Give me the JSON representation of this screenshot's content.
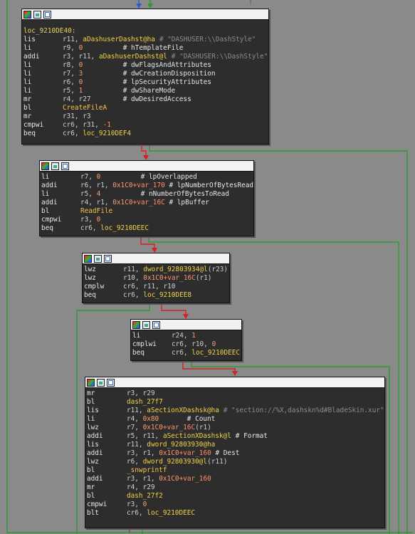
{
  "view": {
    "background": "#8a8a8a",
    "node_background": "#2d2d2d",
    "edge_colors": {
      "taken": "#2e9a2e",
      "fallthrough": "#d32020",
      "unconditional": "#2a5ad8"
    }
  },
  "nodes": [
    {
      "id": "block1",
      "label": "loc_9210DE40:",
      "lines": [
        {
          "m": "lis",
          "parts": [
            {
              "t": "r11, ",
              "k": "reg"
            },
            {
              "t": "aDashuserDashst@ha",
              "k": "sym"
            },
            {
              "t": " # ",
              "k": "cmt"
            },
            {
              "t": "\"DASHUSER:\\\\DashStyle\"",
              "k": "cmt"
            }
          ]
        },
        {
          "m": "li",
          "parts": [
            {
              "t": "r9, ",
              "k": "reg"
            },
            {
              "t": "0",
              "k": "num"
            },
            {
              "t": "          # hTemplateFile",
              "k": "nm"
            }
          ]
        },
        {
          "m": "addi",
          "parts": [
            {
              "t": "r3, r11, ",
              "k": "reg"
            },
            {
              "t": "aDashuserDashst@l",
              "k": "sym"
            },
            {
              "t": " # ",
              "k": "cmt"
            },
            {
              "t": "\"DASHUSER:\\\\DashStyle\"",
              "k": "cmt"
            }
          ]
        },
        {
          "m": "li",
          "parts": [
            {
              "t": "r8, ",
              "k": "reg"
            },
            {
              "t": "0",
              "k": "num"
            },
            {
              "t": "          # dwFlagsAndAttributes",
              "k": "nm"
            }
          ]
        },
        {
          "m": "li",
          "parts": [
            {
              "t": "r7, ",
              "k": "reg"
            },
            {
              "t": "3",
              "k": "num"
            },
            {
              "t": "          # dwCreationDisposition",
              "k": "nm"
            }
          ]
        },
        {
          "m": "li",
          "parts": [
            {
              "t": "r6, ",
              "k": "reg"
            },
            {
              "t": "0",
              "k": "num"
            },
            {
              "t": "          # lpSecurityAttributes",
              "k": "nm"
            }
          ]
        },
        {
          "m": "li",
          "parts": [
            {
              "t": "r5, ",
              "k": "reg"
            },
            {
              "t": "1",
              "k": "num"
            },
            {
              "t": "          # dwShareMode",
              "k": "nm"
            }
          ]
        },
        {
          "m": "mr",
          "parts": [
            {
              "t": "r4, r27",
              "k": "reg"
            },
            {
              "t": "        # dwDesiredAccess",
              "k": "nm"
            }
          ]
        },
        {
          "m": "bl",
          "parts": [
            {
              "t": "CreateFileA",
              "k": "fc"
            }
          ]
        },
        {
          "m": "mr",
          "parts": [
            {
              "t": "r31, r3",
              "k": "reg"
            }
          ]
        },
        {
          "m": "cmpwi",
          "parts": [
            {
              "t": "cr6, r31, ",
              "k": "reg"
            },
            {
              "t": "-1",
              "k": "num"
            }
          ]
        },
        {
          "m": "beq",
          "parts": [
            {
              "t": "cr6, ",
              "k": "reg"
            },
            {
              "t": "loc_9210DEF4",
              "k": "sym"
            }
          ]
        }
      ]
    },
    {
      "id": "block2",
      "label": "",
      "lines": [
        {
          "m": "li",
          "parts": [
            {
              "t": "r7, ",
              "k": "reg"
            },
            {
              "t": "0",
              "k": "num"
            },
            {
              "t": "          # lpOverlapped",
              "k": "nm"
            }
          ]
        },
        {
          "m": "addi",
          "parts": [
            {
              "t": "r6, r1, ",
              "k": "reg"
            },
            {
              "t": "0x1C0",
              "k": "num"
            },
            {
              "t": "+var_170",
              "k": "var"
            },
            {
              "t": " # lpNumberOfBytesRead",
              "k": "nm"
            }
          ]
        },
        {
          "m": "li",
          "parts": [
            {
              "t": "r5, ",
              "k": "reg"
            },
            {
              "t": "4",
              "k": "num"
            },
            {
              "t": "          # nNumberOfBytesToRead",
              "k": "nm"
            }
          ]
        },
        {
          "m": "addi",
          "parts": [
            {
              "t": "r4, r1, ",
              "k": "reg"
            },
            {
              "t": "0x1C0",
              "k": "num"
            },
            {
              "t": "+var_16C",
              "k": "var"
            },
            {
              "t": " # lpBuffer",
              "k": "nm"
            }
          ]
        },
        {
          "m": "bl",
          "parts": [
            {
              "t": "ReadFile",
              "k": "fc"
            }
          ]
        },
        {
          "m": "cmpwi",
          "parts": [
            {
              "t": "r3, ",
              "k": "reg"
            },
            {
              "t": "0",
              "k": "num"
            }
          ]
        },
        {
          "m": "beq",
          "parts": [
            {
              "t": "cr6, ",
              "k": "reg"
            },
            {
              "t": "loc_9210DEEC",
              "k": "sym"
            }
          ]
        }
      ]
    },
    {
      "id": "block3",
      "label": "",
      "lines": [
        {
          "m": "lwz",
          "parts": [
            {
              "t": "r11, ",
              "k": "reg"
            },
            {
              "t": "dword_92803934@l",
              "k": "sym"
            },
            {
              "t": "(r23)",
              "k": "reg"
            }
          ]
        },
        {
          "m": "lwz",
          "parts": [
            {
              "t": "r10, ",
              "k": "reg"
            },
            {
              "t": "0x1C0",
              "k": "num"
            },
            {
              "t": "+var_16C",
              "k": "var"
            },
            {
              "t": "(r1)",
              "k": "reg"
            }
          ]
        },
        {
          "m": "cmplw",
          "parts": [
            {
              "t": "cr6, r11, r10",
              "k": "reg"
            }
          ]
        },
        {
          "m": "beq",
          "parts": [
            {
              "t": "cr6, ",
              "k": "reg"
            },
            {
              "t": "loc_9210DEE8",
              "k": "sym"
            }
          ]
        }
      ]
    },
    {
      "id": "block4",
      "label": "",
      "lines": [
        {
          "m": "li",
          "parts": [
            {
              "t": "r24, ",
              "k": "reg"
            },
            {
              "t": "1",
              "k": "num"
            }
          ]
        },
        {
          "m": "cmplwi",
          "parts": [
            {
              "t": "cr6, r10, ",
              "k": "reg"
            },
            {
              "t": "0",
              "k": "num"
            }
          ]
        },
        {
          "m": "beq",
          "parts": [
            {
              "t": "cr6, ",
              "k": "reg"
            },
            {
              "t": "loc_9210DEEC",
              "k": "sym"
            }
          ]
        }
      ]
    },
    {
      "id": "block5",
      "label": "",
      "lines": [
        {
          "m": "mr",
          "parts": [
            {
              "t": "r3, r29",
              "k": "reg"
            }
          ]
        },
        {
          "m": "bl",
          "parts": [
            {
              "t": "dash_27f7",
              "k": "sym"
            }
          ]
        },
        {
          "m": "lis",
          "parts": [
            {
              "t": "r11, ",
              "k": "reg"
            },
            {
              "t": "aSectionXDashsk@ha",
              "k": "sym"
            },
            {
              "t": " # ",
              "k": "cmt"
            },
            {
              "t": "\"section://%X,dashskn%d#BladeSkin.xur\"",
              "k": "cmt"
            }
          ]
        },
        {
          "m": "li",
          "parts": [
            {
              "t": "r4, ",
              "k": "reg"
            },
            {
              "t": "0x80",
              "k": "num"
            },
            {
              "t": "       # Count",
              "k": "nm"
            }
          ]
        },
        {
          "m": "lwz",
          "parts": [
            {
              "t": "r7, ",
              "k": "reg"
            },
            {
              "t": "0x1C0",
              "k": "num"
            },
            {
              "t": "+var_16C",
              "k": "var"
            },
            {
              "t": "(r1)",
              "k": "reg"
            }
          ]
        },
        {
          "m": "addi",
          "parts": [
            {
              "t": "r5, r11, ",
              "k": "reg"
            },
            {
              "t": "aSectionXDashsk@l",
              "k": "sym"
            },
            {
              "t": " # Format",
              "k": "nm"
            }
          ]
        },
        {
          "m": "lis",
          "parts": [
            {
              "t": "r11, ",
              "k": "reg"
            },
            {
              "t": "dword_92803930@ha",
              "k": "sym"
            }
          ]
        },
        {
          "m": "addi",
          "parts": [
            {
              "t": "r3, r1, ",
              "k": "reg"
            },
            {
              "t": "0x1C0",
              "k": "num"
            },
            {
              "t": "+var_160",
              "k": "var"
            },
            {
              "t": " # Dest",
              "k": "nm"
            }
          ]
        },
        {
          "m": "lwz",
          "parts": [
            {
              "t": "r6, ",
              "k": "reg"
            },
            {
              "t": "dword_92803930@l",
              "k": "sym"
            },
            {
              "t": "(r11)",
              "k": "reg"
            }
          ]
        },
        {
          "m": "bl",
          "parts": [
            {
              "t": "_snwprintf",
              "k": "fc"
            }
          ]
        },
        {
          "m": "addi",
          "parts": [
            {
              "t": "r3, r1, ",
              "k": "reg"
            },
            {
              "t": "0x1C0",
              "k": "num"
            },
            {
              "t": "+var_160",
              "k": "var"
            }
          ]
        },
        {
          "m": "mr",
          "parts": [
            {
              "t": "r4, r29",
              "k": "reg"
            }
          ]
        },
        {
          "m": "bl",
          "parts": [
            {
              "t": "dash_27f2",
              "k": "sym"
            }
          ]
        },
        {
          "m": "cmpwi",
          "parts": [
            {
              "t": "r3, ",
              "k": "reg"
            },
            {
              "t": "0",
              "k": "num"
            }
          ]
        },
        {
          "m": "blt",
          "parts": [
            {
              "t": "cr6, ",
              "k": "reg"
            },
            {
              "t": "loc_9210DEEC",
              "k": "sym"
            }
          ]
        }
      ]
    }
  ]
}
